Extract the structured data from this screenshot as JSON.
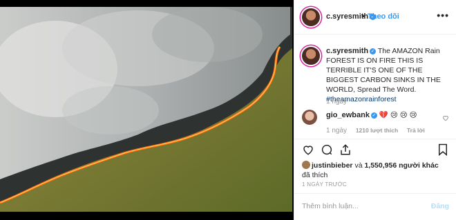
{
  "post": {
    "username": "c.syresmith",
    "follow_label": "Theo dõi",
    "dot_separator": "•",
    "more_label": "•••",
    "caption_text": "The AMAZON Rain FOREST IS ON FIRE THIS IS TERRIBLE IT'S ONE OF THE BIGGEST CARBON SINKS IN THE WORLD, Spread The Word.",
    "caption_hashtag": "#theamazonrainforest",
    "caption_age": "1 ngày"
  },
  "comment": {
    "username": "gio_ewbank",
    "emojis": "💔 😢 😢 😢",
    "age": "1 ngày",
    "likes": "1210 lượt thích",
    "reply_label": "Trả lời"
  },
  "likes": {
    "first_liker": "justinbieber",
    "connector": "và",
    "others_count": "1,550,956",
    "others_label": "người khác",
    "suffix": "đã thích"
  },
  "timestamp": "1 NGÀY TRƯỚC",
  "add_comment": {
    "placeholder": "Thêm bình luận...",
    "post_label": "Đăng"
  },
  "colors": {
    "accent": "#3897f0",
    "fire": "#ff6a10",
    "forest": "#6a7a30"
  }
}
